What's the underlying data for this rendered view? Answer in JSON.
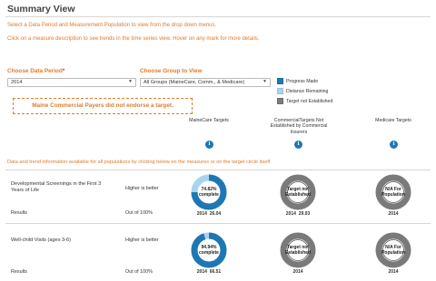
{
  "page": {
    "title": "Summary View"
  },
  "instructions": {
    "line1": "Select a Data Period and Measurement Population to view from the drop down menus.",
    "line2": "Click on a measure description to see trends in the time series view. Hover on any mark for more details."
  },
  "filters": {
    "period_label": "Choose Data Period",
    "period_required": "*",
    "period_value": "2014",
    "group_label": "Choose Group to View",
    "group_value": "All Groups (MaineCare, Comm., & Medicare)"
  },
  "legend": {
    "items": [
      {
        "label": "Progress Made",
        "color": "#1d77b5"
      },
      {
        "label": "Distance Remaining",
        "color": "#a8d3f1"
      },
      {
        "label": "Target not Established",
        "color": "#7a7a7a"
      }
    ]
  },
  "notice": "Maine Commercial Payers did not endorse a target.",
  "columns": [
    {
      "label": "MaineCare Targets"
    },
    {
      "label": "CommercialTargets Not Established by Commercial Insurers"
    },
    {
      "label": "Medicare Targets"
    }
  ],
  "note": "Data and trend information available for all populations by clicking below on the measures or on the target circle itself",
  "measures": [
    {
      "name": "Developmental Screenings in the First 3 Years of Life",
      "direction": "Higher is better",
      "results_label": "Results",
      "out_of": "Out of 100%",
      "rings": [
        {
          "type": "progress",
          "progress": 0.7482,
          "text": "74.82% complete",
          "year": "2014",
          "value": "26.04"
        },
        {
          "type": "na",
          "text": "Target not Established",
          "year": "2014",
          "value": "29.03"
        },
        {
          "type": "na",
          "text": "N/A For Population",
          "year": "2014",
          "value": ""
        }
      ]
    },
    {
      "name": "Well-child Visits (ages 3-6)",
      "direction": "Higher is better",
      "results_label": "Results",
      "out_of": "Out of 100%",
      "rings": [
        {
          "type": "progress",
          "progress": 0.9494,
          "text": "94.94% complete",
          "year": "2014",
          "value": "66.51"
        },
        {
          "type": "na",
          "text": "Target not Established",
          "year": "2014",
          "value": ""
        },
        {
          "type": "na",
          "text": "N/A For Population",
          "year": "2014",
          "value": ""
        }
      ]
    }
  ]
}
